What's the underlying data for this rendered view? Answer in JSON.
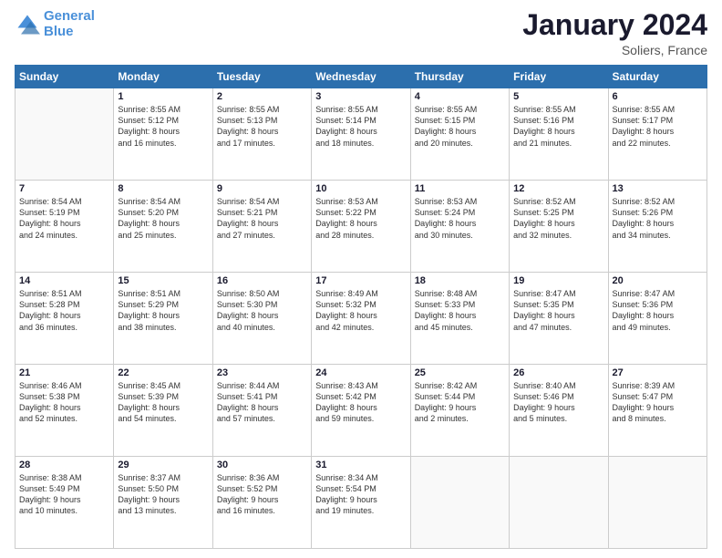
{
  "header": {
    "logo_line1": "General",
    "logo_line2": "Blue",
    "title": "January 2024",
    "subtitle": "Soliers, France"
  },
  "calendar": {
    "days_of_week": [
      "Sunday",
      "Monday",
      "Tuesday",
      "Wednesday",
      "Thursday",
      "Friday",
      "Saturday"
    ],
    "weeks": [
      [
        {
          "day": "",
          "info": ""
        },
        {
          "day": "1",
          "info": "Sunrise: 8:55 AM\nSunset: 5:12 PM\nDaylight: 8 hours\nand 16 minutes."
        },
        {
          "day": "2",
          "info": "Sunrise: 8:55 AM\nSunset: 5:13 PM\nDaylight: 8 hours\nand 17 minutes."
        },
        {
          "day": "3",
          "info": "Sunrise: 8:55 AM\nSunset: 5:14 PM\nDaylight: 8 hours\nand 18 minutes."
        },
        {
          "day": "4",
          "info": "Sunrise: 8:55 AM\nSunset: 5:15 PM\nDaylight: 8 hours\nand 20 minutes."
        },
        {
          "day": "5",
          "info": "Sunrise: 8:55 AM\nSunset: 5:16 PM\nDaylight: 8 hours\nand 21 minutes."
        },
        {
          "day": "6",
          "info": "Sunrise: 8:55 AM\nSunset: 5:17 PM\nDaylight: 8 hours\nand 22 minutes."
        }
      ],
      [
        {
          "day": "7",
          "info": "Sunrise: 8:54 AM\nSunset: 5:19 PM\nDaylight: 8 hours\nand 24 minutes."
        },
        {
          "day": "8",
          "info": "Sunrise: 8:54 AM\nSunset: 5:20 PM\nDaylight: 8 hours\nand 25 minutes."
        },
        {
          "day": "9",
          "info": "Sunrise: 8:54 AM\nSunset: 5:21 PM\nDaylight: 8 hours\nand 27 minutes."
        },
        {
          "day": "10",
          "info": "Sunrise: 8:53 AM\nSunset: 5:22 PM\nDaylight: 8 hours\nand 28 minutes."
        },
        {
          "day": "11",
          "info": "Sunrise: 8:53 AM\nSunset: 5:24 PM\nDaylight: 8 hours\nand 30 minutes."
        },
        {
          "day": "12",
          "info": "Sunrise: 8:52 AM\nSunset: 5:25 PM\nDaylight: 8 hours\nand 32 minutes."
        },
        {
          "day": "13",
          "info": "Sunrise: 8:52 AM\nSunset: 5:26 PM\nDaylight: 8 hours\nand 34 minutes."
        }
      ],
      [
        {
          "day": "14",
          "info": "Sunrise: 8:51 AM\nSunset: 5:28 PM\nDaylight: 8 hours\nand 36 minutes."
        },
        {
          "day": "15",
          "info": "Sunrise: 8:51 AM\nSunset: 5:29 PM\nDaylight: 8 hours\nand 38 minutes."
        },
        {
          "day": "16",
          "info": "Sunrise: 8:50 AM\nSunset: 5:30 PM\nDaylight: 8 hours\nand 40 minutes."
        },
        {
          "day": "17",
          "info": "Sunrise: 8:49 AM\nSunset: 5:32 PM\nDaylight: 8 hours\nand 42 minutes."
        },
        {
          "day": "18",
          "info": "Sunrise: 8:48 AM\nSunset: 5:33 PM\nDaylight: 8 hours\nand 45 minutes."
        },
        {
          "day": "19",
          "info": "Sunrise: 8:47 AM\nSunset: 5:35 PM\nDaylight: 8 hours\nand 47 minutes."
        },
        {
          "day": "20",
          "info": "Sunrise: 8:47 AM\nSunset: 5:36 PM\nDaylight: 8 hours\nand 49 minutes."
        }
      ],
      [
        {
          "day": "21",
          "info": "Sunrise: 8:46 AM\nSunset: 5:38 PM\nDaylight: 8 hours\nand 52 minutes."
        },
        {
          "day": "22",
          "info": "Sunrise: 8:45 AM\nSunset: 5:39 PM\nDaylight: 8 hours\nand 54 minutes."
        },
        {
          "day": "23",
          "info": "Sunrise: 8:44 AM\nSunset: 5:41 PM\nDaylight: 8 hours\nand 57 minutes."
        },
        {
          "day": "24",
          "info": "Sunrise: 8:43 AM\nSunset: 5:42 PM\nDaylight: 8 hours\nand 59 minutes."
        },
        {
          "day": "25",
          "info": "Sunrise: 8:42 AM\nSunset: 5:44 PM\nDaylight: 9 hours\nand 2 minutes."
        },
        {
          "day": "26",
          "info": "Sunrise: 8:40 AM\nSunset: 5:46 PM\nDaylight: 9 hours\nand 5 minutes."
        },
        {
          "day": "27",
          "info": "Sunrise: 8:39 AM\nSunset: 5:47 PM\nDaylight: 9 hours\nand 8 minutes."
        }
      ],
      [
        {
          "day": "28",
          "info": "Sunrise: 8:38 AM\nSunset: 5:49 PM\nDaylight: 9 hours\nand 10 minutes."
        },
        {
          "day": "29",
          "info": "Sunrise: 8:37 AM\nSunset: 5:50 PM\nDaylight: 9 hours\nand 13 minutes."
        },
        {
          "day": "30",
          "info": "Sunrise: 8:36 AM\nSunset: 5:52 PM\nDaylight: 9 hours\nand 16 minutes."
        },
        {
          "day": "31",
          "info": "Sunrise: 8:34 AM\nSunset: 5:54 PM\nDaylight: 9 hours\nand 19 minutes."
        },
        {
          "day": "",
          "info": ""
        },
        {
          "day": "",
          "info": ""
        },
        {
          "day": "",
          "info": ""
        }
      ]
    ]
  }
}
